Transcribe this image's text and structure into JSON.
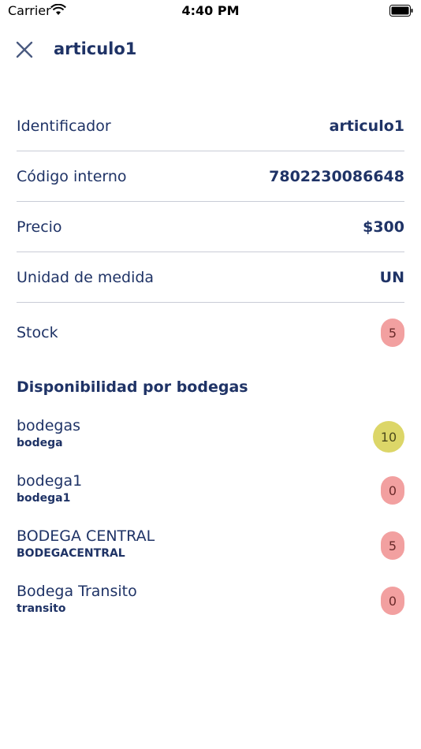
{
  "status_bar": {
    "carrier": "Carrier",
    "time": "4:40 PM"
  },
  "header": {
    "title": "articulo1"
  },
  "details": [
    {
      "label": "Identificador",
      "value": "articulo1"
    },
    {
      "label": "Código interno",
      "value": "7802230086648"
    },
    {
      "label": "Precio",
      "value": "$300"
    },
    {
      "label": "Unidad de medida",
      "value": "UN"
    }
  ],
  "stock": {
    "label": "Stock",
    "value": "5"
  },
  "warehouses_section": {
    "title": "Disponibilidad por bodegas"
  },
  "warehouses": [
    {
      "name": "bodegas",
      "code": "bodega",
      "qty": "10",
      "color": "#dcd668"
    },
    {
      "name": "bodega1",
      "code": "bodega1",
      "qty": "0",
      "color": "#f2a0a0"
    },
    {
      "name": "BODEGA CENTRAL",
      "code": "BODEGACENTRAL",
      "qty": "5",
      "color": "#f2a0a0"
    },
    {
      "name": "Bodega Transito",
      "code": "transito",
      "qty": "0",
      "color": "#f2a0a0"
    }
  ],
  "colors": {
    "text": "#1f3366",
    "divider": "#c9ccd6",
    "badge_red": "#f2a0a0",
    "badge_yellow": "#dcd668"
  }
}
